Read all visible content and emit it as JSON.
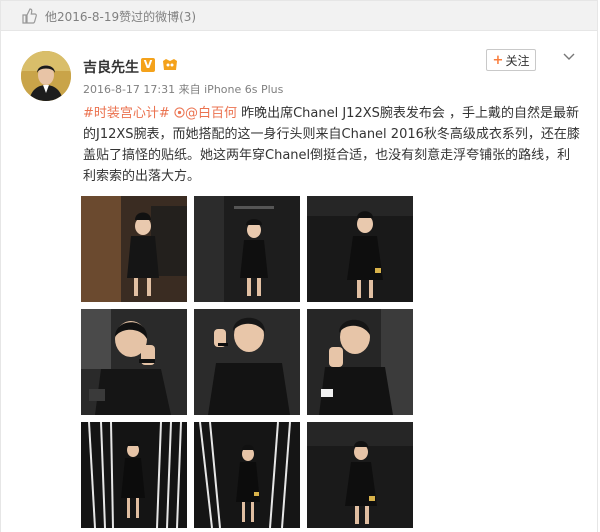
{
  "liked_bar": {
    "text": "他2016-8-19赞过的微博(3)"
  },
  "post": {
    "username": "吉良先生",
    "verified_badge": "V",
    "timestamp": "2016-8-17 17:31",
    "source_prefix": "来自",
    "source_device": "iPhone 6s Plus",
    "follow_label": "关注",
    "hashtag": "#时装宫心计#",
    "mention": "@白百何",
    "text_body": " 昨晚出席Chanel J12XS腕表发布会 ，手上戴的自然是最新的J12XS腕表，而她搭配的这一身行头则来自Chanel 2016秋冬高级成衣系列，还在膝盖贴了搞怪的贴纸。她这两年穿Chanel倒挺合适，也没有刻意走浮夸铺张的路线，利利索索的出落大方。"
  },
  "photos": [
    {
      "name": "photo-1"
    },
    {
      "name": "photo-2"
    },
    {
      "name": "photo-3"
    },
    {
      "name": "photo-4"
    },
    {
      "name": "photo-5"
    },
    {
      "name": "photo-6"
    },
    {
      "name": "photo-7"
    },
    {
      "name": "photo-8"
    },
    {
      "name": "photo-9"
    }
  ],
  "colors": {
    "link": "#eb7350",
    "badge": "#f4a21b",
    "meta": "#808080"
  }
}
